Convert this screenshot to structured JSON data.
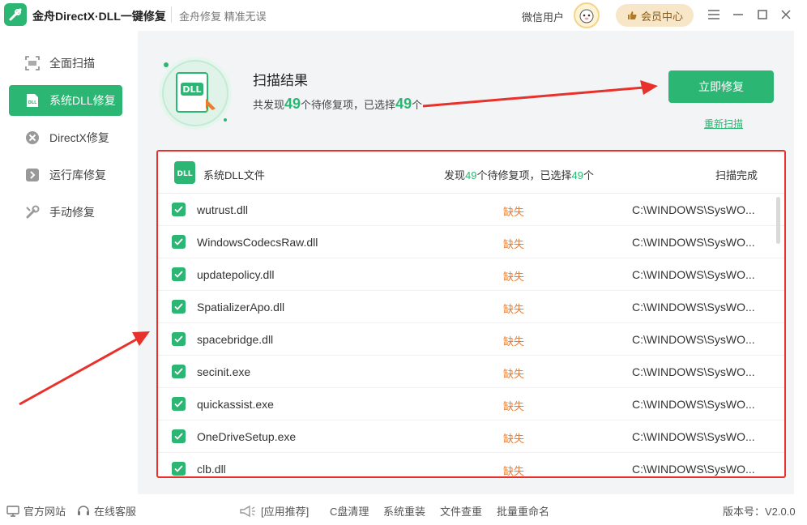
{
  "app": {
    "title": "金舟DirectX·DLL一键修复",
    "slogan": "金舟修复 精准无误",
    "user_name": "微信用户",
    "vip_label": "会员中心"
  },
  "sidebar": {
    "items": [
      {
        "label": "全面扫描",
        "icon": "scan-icon"
      },
      {
        "label": "系统DLL修复",
        "icon": "dll-icon",
        "active": true
      },
      {
        "label": "DirectX修复",
        "icon": "directx-icon"
      },
      {
        "label": "运行库修复",
        "icon": "runtime-icon"
      },
      {
        "label": "手动修复",
        "icon": "tools-icon"
      }
    ]
  },
  "hero": {
    "title": "扫描结果",
    "sub_prefix": "共发现",
    "found": "49",
    "sub_mid": "个待修复项，已选择",
    "selected": "49",
    "sub_suffix": "个",
    "icon_text": "DLL",
    "fix_label": "立即修复",
    "rescan_label": "重新扫描"
  },
  "panel": {
    "icon_text": "DLL",
    "title": "系统DLL文件",
    "found_prefix": "发现",
    "found": "49",
    "found_mid": "个待修复项，已选择",
    "selected": "49",
    "found_suffix": "个",
    "status": "扫描完成",
    "rows": [
      {
        "name": "wutrust.dll",
        "status": "缺失",
        "path": "C:\\WINDOWS\\SysWO..."
      },
      {
        "name": "WindowsCodecsRaw.dll",
        "status": "缺失",
        "path": "C:\\WINDOWS\\SysWO..."
      },
      {
        "name": "updatepolicy.dll",
        "status": "缺失",
        "path": "C:\\WINDOWS\\SysWO..."
      },
      {
        "name": "SpatializerApo.dll",
        "status": "缺失",
        "path": "C:\\WINDOWS\\SysWO..."
      },
      {
        "name": "spacebridge.dll",
        "status": "缺失",
        "path": "C:\\WINDOWS\\SysWO..."
      },
      {
        "name": "secinit.exe",
        "status": "缺失",
        "path": "C:\\WINDOWS\\SysWO..."
      },
      {
        "name": "quickassist.exe",
        "status": "缺失",
        "path": "C:\\WINDOWS\\SysWO..."
      },
      {
        "name": "OneDriveSetup.exe",
        "status": "缺失",
        "path": "C:\\WINDOWS\\SysWO..."
      },
      {
        "name": "clb.dll",
        "status": "缺失",
        "path": "C:\\WINDOWS\\SysWO..."
      }
    ]
  },
  "footer": {
    "website": "官方网站",
    "support": "在线客服",
    "recommend": "[应用推荐]",
    "links": [
      "C盘清理",
      "系统重装",
      "文件查重",
      "批量重命名"
    ],
    "version": "版本号：V2.0.0"
  },
  "colors": {
    "accent": "#2bb673",
    "warning": "#f07b2d",
    "highlight": "#e8312a"
  }
}
